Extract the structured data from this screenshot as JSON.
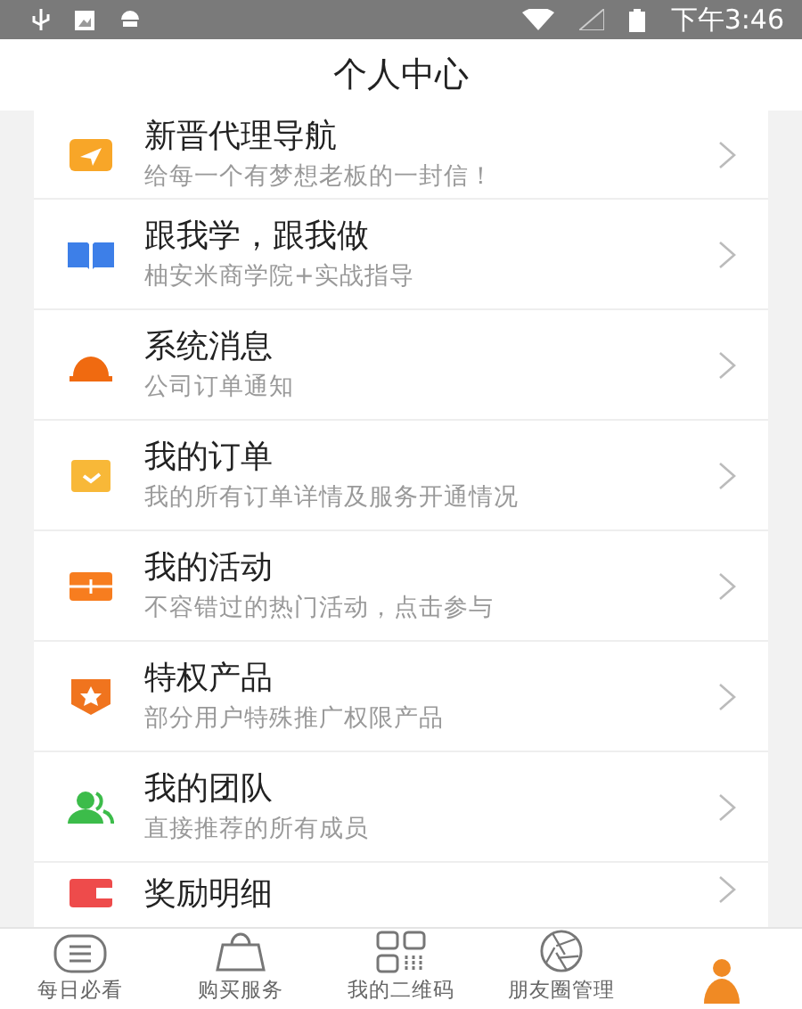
{
  "status_bar": {
    "time": "下午3:46"
  },
  "header": {
    "title": "个人中心"
  },
  "menu": [
    {
      "title": "新晋代理导航",
      "subtitle": "给每一个有梦想老板的一封信！"
    },
    {
      "title": "跟我学，跟我做",
      "subtitle": "柚安米商学院+实战指导"
    },
    {
      "title": "系统消息",
      "subtitle": "公司订单通知"
    },
    {
      "title": "我的订单",
      "subtitle": "我的所有订单详情及服务开通情况"
    },
    {
      "title": "我的活动",
      "subtitle": "不容错过的热门活动，点击参与"
    },
    {
      "title": "特权产品",
      "subtitle": "部分用户特殊推广权限产品"
    },
    {
      "title": "我的团队",
      "subtitle": "直接推荐的所有成员"
    },
    {
      "title": "奖励明细"
    }
  ],
  "tab_bar": [
    {
      "label": "每日必看",
      "selected": false
    },
    {
      "label": "购买服务",
      "selected": false
    },
    {
      "label": "我的二维码",
      "selected": false
    },
    {
      "label": "朋友圈管理",
      "selected": false
    },
    {
      "selected": true
    }
  ]
}
